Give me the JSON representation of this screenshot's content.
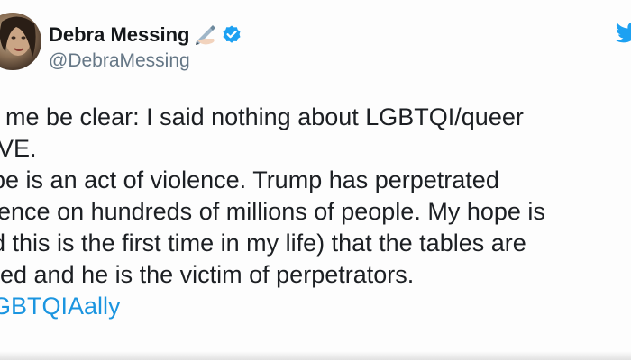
{
  "tweet": {
    "author_name": "Debra Messing",
    "author_handle": "@DebraMessing",
    "lines": [
      "et me be clear: I said nothing about LGBTQI/queer",
      "OVE.",
      "ape is an act of violence. Trump has perpetrated",
      "olence on hundreds of millions of people. My hope is",
      "nd this is the first time in my life) that the tables are",
      "rned and he is the victim of perpetrators."
    ],
    "hashtag": "LGBTQIAally"
  },
  "icons": {
    "pen": "writing-hand-icon",
    "verified": "verified-badge-icon",
    "bird": "twitter-bird-icon"
  },
  "colors": {
    "verified": "#1da1f2",
    "hashtag": "#1b95e0",
    "handle": "#657786"
  }
}
